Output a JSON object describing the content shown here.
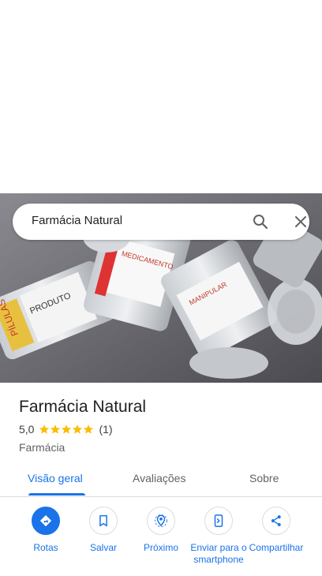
{
  "search": {
    "query": "Farmácia Natural",
    "search_icon": "search-icon",
    "clear_icon": "close-icon"
  },
  "place": {
    "name": "Farmácia Natural",
    "rating": "5,0",
    "stars": 5,
    "review_count": "(1)",
    "category": "Farmácia"
  },
  "photo": {
    "labels": [
      "PÍLULAS",
      "PRODUTO",
      "MEDICAMENTO",
      "MANIPULAR"
    ]
  },
  "tabs": [
    {
      "label": "Visão geral",
      "active": true
    },
    {
      "label": "Avaliações",
      "active": false
    },
    {
      "label": "Sobre",
      "active": false
    }
  ],
  "actions": [
    {
      "label": "Rotas",
      "icon": "directions-icon"
    },
    {
      "label": "Salvar",
      "icon": "bookmark-icon"
    },
    {
      "label": "Próximo",
      "icon": "nearby-icon"
    },
    {
      "label": "Enviar para o smartphone",
      "icon": "send-to-phone-icon"
    },
    {
      "label": "Compartilhar",
      "icon": "share-icon"
    }
  ],
  "colors": {
    "accent": "#1a73e8",
    "star": "#fbbc04",
    "text": "#202124",
    "muted": "#5f6368"
  }
}
